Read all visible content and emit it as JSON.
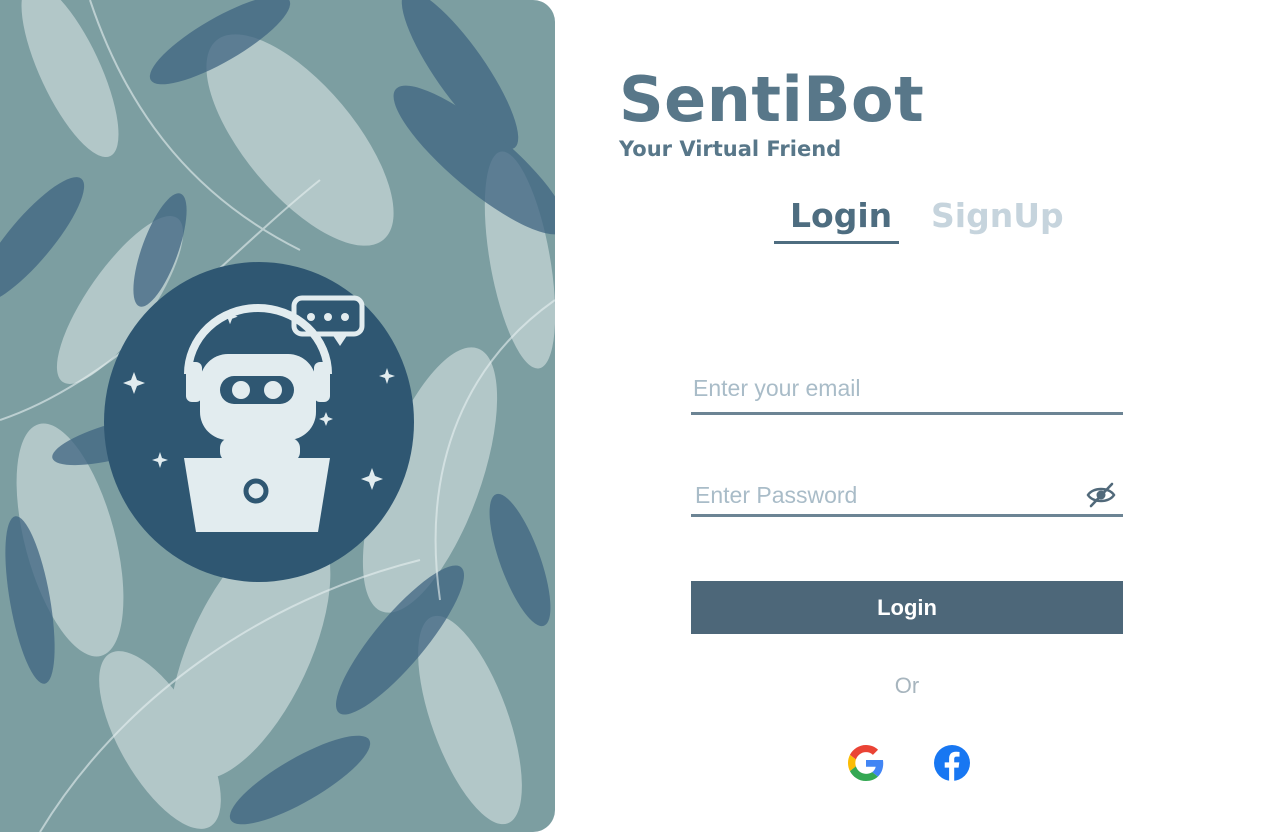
{
  "brand": {
    "title": "SentiBot",
    "tagline": "Your Virtual Friend"
  },
  "tabs": {
    "login": "Login",
    "signup": "SignUp",
    "active": "Login"
  },
  "form": {
    "email_placeholder": "Enter your email",
    "email_value": "",
    "password_placeholder": "Enter Password",
    "password_value": "",
    "password_toggle_icon": "eye-slash-icon",
    "submit_label": "Login"
  },
  "divider": {
    "text": "Or"
  },
  "social": [
    {
      "provider": "google",
      "icon": "google-icon"
    },
    {
      "provider": "facebook",
      "icon": "facebook-icon"
    }
  ],
  "colors": {
    "primary": "#4d6779",
    "brand_text": "#587789",
    "inactive_tab": "#c6d4dd",
    "hero_background": "#7c9ea1",
    "bot_circle": "#2f5772"
  }
}
